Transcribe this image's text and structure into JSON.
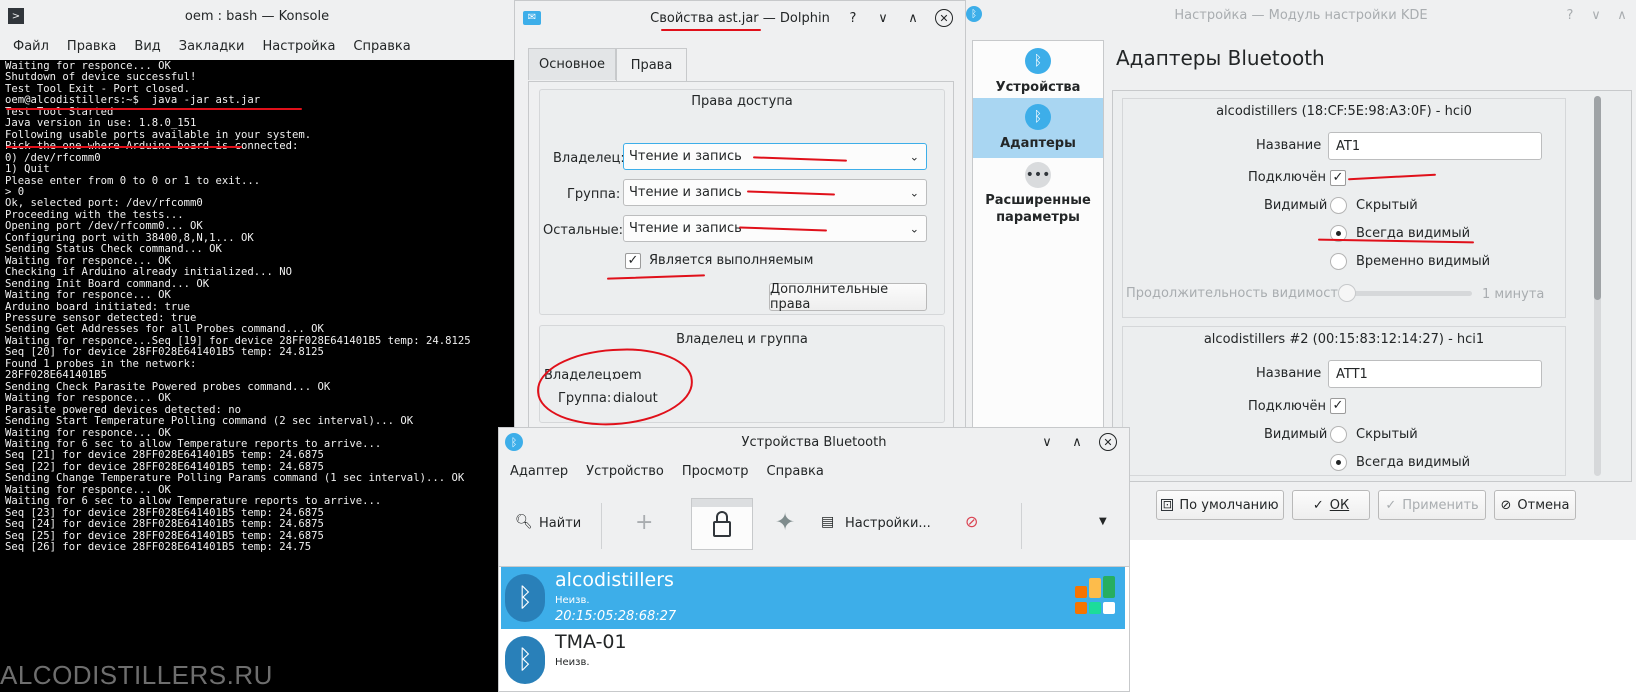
{
  "konsole": {
    "title": "oem : bash — Konsole",
    "menu": [
      "Файл",
      "Правка",
      "Вид",
      "Закладки",
      "Настройка",
      "Справка"
    ],
    "lines": [
      "Waiting for responce... OK",
      "Shutdown of device successful!",
      "Test Tool Exit - Port closed.",
      "oem@alcodistillers:~$  java -jar ast.jar",
      "",
      "Test Tool Started",
      "Java version in use: 1.8.0_151",
      "",
      "Following usable ports available in your system.",
      "Pick the one where Arduino board is connected:",
      "",
      "0) /dev/rfcomm0",
      "1) Quit",
      "",
      "Please enter from 0 to 0 or 1 to exit...",
      "> 0",
      "Ok, selected port: /dev/rfcomm0",
      "Proceeding with the tests...",
      "",
      "Opening port /dev/rfcomm0... OK",
      "Configuring port with 38400,8,N,1... OK",
      "Sending Status Check command... OK",
      "Waiting for responce... OK",
      "Checking if Arduino already initialized... NO",
      "Sending Init Board command... OK",
      "Waiting for responce... OK",
      "Arduino board initiated: true",
      "Pressure sensor detected: true",
      "Sending Get Addresses for all Probes command... OK",
      "Waiting for responce...Seq [19] for device 28FF028E641401B5 temp: 24.8125",
      "Seq [20] for device 28FF028E641401B5 temp: 24.8125",
      "",
      "",
      "Found 1 probes in the network:",
      "28FF028E641401B5",
      "",
      "",
      "Sending Check Parasite Powered probes command... OK",
      "Waiting for responce... OK",
      "Parasite powered devices detected: no",
      "Sending Start Temperature Polling command (2 sec interval)... OK",
      "Waiting for responce... OK",
      "Waiting for 6 sec to allow Temperature reports to arrive...",
      "Seq [21] for device 28FF028E641401B5 temp: 24.6875",
      "Seq [22] for device 28FF028E641401B5 temp: 24.6875",
      "Sending Change Temperature Polling Params command (1 sec interval)... OK",
      "Waiting for responce... OK",
      "Waiting for 6 sec to allow Temperature reports to arrive...",
      "Seq [23] for device 28FF028E641401B5 temp: 24.6875",
      "Seq [24] for device 28FF028E641401B5 temp: 24.6875",
      "Seq [25] for device 28FF028E641401B5 temp: 24.6875",
      "Seq [26] for device 28FF028E641401B5 temp: 24.75"
    ],
    "watermark": "ALCODISTILLERS.RU"
  },
  "dolphin": {
    "title": "Свойства ast.jar — Dolphin",
    "tabs": [
      "Основное",
      "Права"
    ],
    "access_group_title": "Права доступа",
    "owner_label": "Владелец:",
    "group_label": "Группа:",
    "others_label": "Остальные:",
    "owner_value": "Чтение и запись",
    "group_value": "Чтение и запись",
    "others_value": "Чтение и запись",
    "executable_label": "Является выполняемым",
    "advanced_button": "Дополнительные права",
    "owner_group_title": "Владелец и группа",
    "owner_name_label": "Владелец:",
    "owner_name_value": "oem",
    "group_name_label": "Группа:",
    "group_name_value": "dialout"
  },
  "kde": {
    "title": "Настройка — Модуль настройки KDE",
    "sidebar": [
      "Устройства",
      "Адаптеры",
      "Расширенные параметры"
    ],
    "heading": "Адаптеры Bluetooth",
    "adapter1": {
      "title": "alcodistillers (18:CF:5E:98:A3:0F) - hci0",
      "name_label": "Название",
      "name_value": "AT1",
      "connected_label": "Подключён",
      "visible_label": "Видимый",
      "opt_hidden": "Скрытый",
      "opt_always": "Всегда видимый",
      "opt_temp": "Временно видимый",
      "duration_label": "Продолжительность видимости",
      "duration_value": "1 минута",
      "duration_fraction": 0
    },
    "adapter2": {
      "title": "alcodistillers #2 (00:15:83:12:14:27) - hci1",
      "name_label": "Название",
      "name_value": "ATT1",
      "connected_label": "Подключён",
      "visible_label": "Видимый",
      "opt_hidden": "Скрытый",
      "opt_always": "Всегда видимый"
    },
    "buttons": {
      "defaults": "По умолчанию",
      "ok": "ОК",
      "apply": "Применить",
      "cancel": "Отмена"
    }
  },
  "bt": {
    "title": "Устройства Bluetooth",
    "menu": [
      "Адаптер",
      "Устройство",
      "Просмотр",
      "Справка"
    ],
    "toolbar": {
      "find": "Найти",
      "settings": "Настройки..."
    },
    "devices": [
      {
        "name": "alcodistillers",
        "type": "Неизв.",
        "addr": "20:15:05:28:68:27"
      },
      {
        "name": "TMA-01",
        "type": "Неизв."
      }
    ]
  },
  "colors": {
    "accent": "#3daee9",
    "annotation": "#e0101a",
    "terminal_bg": "#000000",
    "window_bg": "#eff0f1"
  }
}
